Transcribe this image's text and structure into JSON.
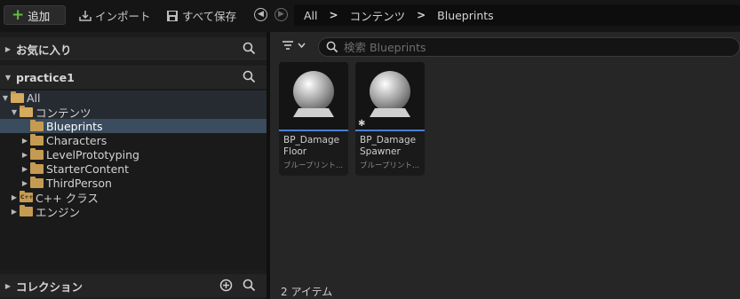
{
  "toolbar": {
    "add_label": "追加",
    "import_label": "インポート",
    "save_all_label": "すべて保存"
  },
  "breadcrumb": {
    "items": [
      "All",
      "コンテンツ",
      "Blueprints"
    ]
  },
  "sidebar": {
    "favorites_title": "お気に入り",
    "project_title": "practice1",
    "collections_title": "コレクション",
    "tree": [
      {
        "label": "All"
      },
      {
        "label": "コンテンツ"
      },
      {
        "label": "Blueprints"
      },
      {
        "label": "Characters"
      },
      {
        "label": "LevelPrototyping"
      },
      {
        "label": "StarterContent"
      },
      {
        "label": "ThirdPerson"
      },
      {
        "label": "C++ クラス"
      },
      {
        "label": "エンジン"
      }
    ]
  },
  "content": {
    "search_placeholder": "検索 Blueprints",
    "assets": [
      {
        "name": "BP_Damage Floor",
        "line1": "BP_Damage",
        "line2": "Floor",
        "type": "ブループリント..."
      },
      {
        "name": "BP_Damage Spawner",
        "line1": "BP_Damage",
        "line2": "Spawner",
        "type": "ブループリント..."
      }
    ],
    "item_count": "2 アイテム"
  },
  "colors": {
    "accent_add": "#5fbf3a",
    "selection": "#3a4c5e",
    "asset_underline": "#4a7fd4",
    "folder": "#c59a52"
  },
  "icons": [
    "plus-icon",
    "import-icon",
    "save-icon",
    "back-icon",
    "forward-icon",
    "search-icon",
    "filter-icon",
    "add-circle-icon",
    "folder-icon",
    "folder-open-icon",
    "cpp-folder-icon"
  ]
}
